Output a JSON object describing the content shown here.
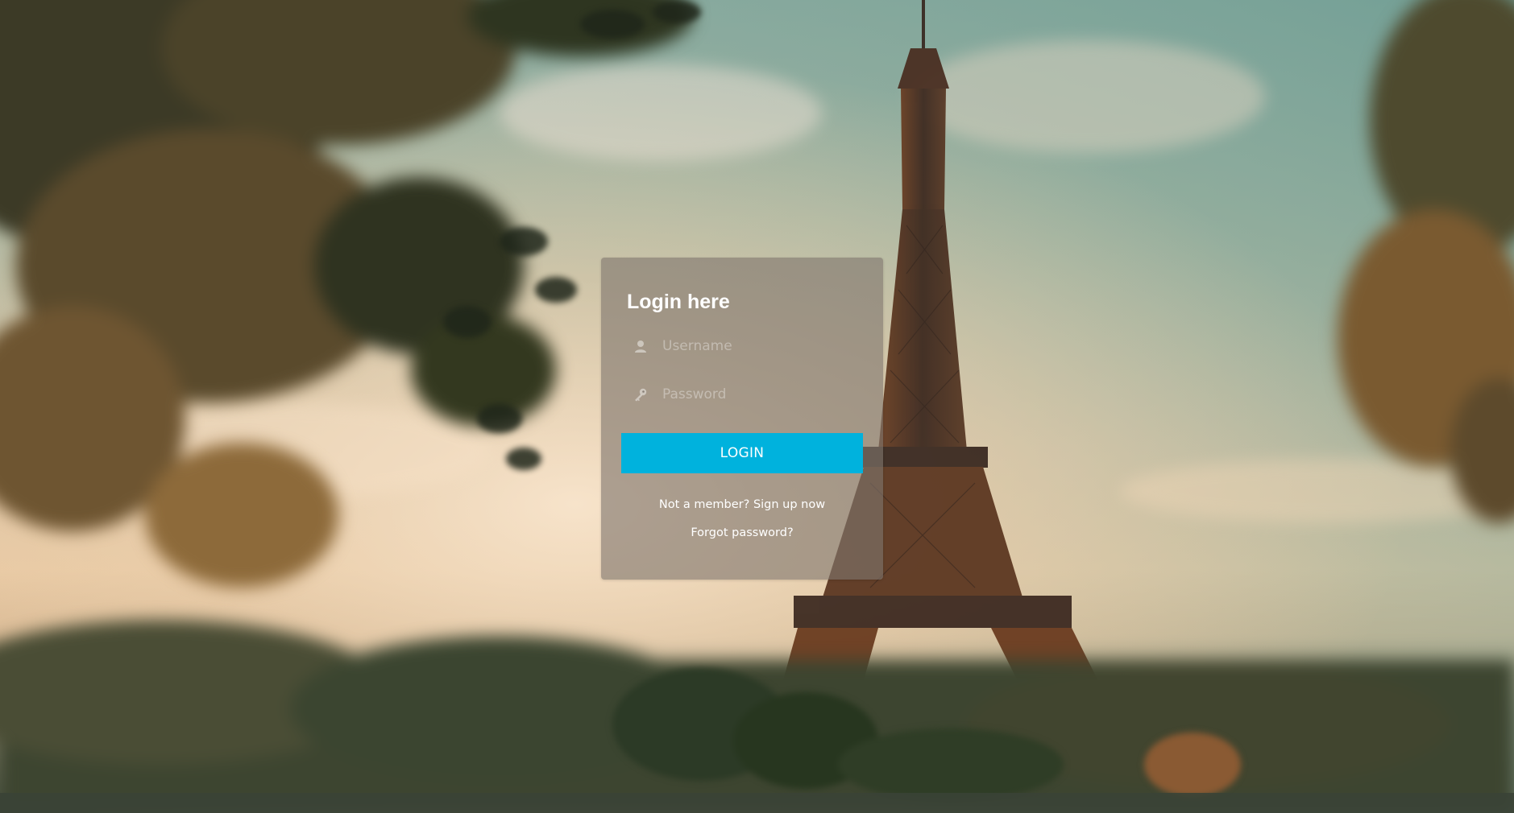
{
  "login": {
    "title": "Login here",
    "username_placeholder": "Username",
    "password_placeholder": "Password",
    "login_label": "LOGIN",
    "signup_link": "Not a member? Sign up now",
    "forgot_link": "Forgot password?"
  },
  "icons": {
    "username": "user-icon",
    "password": "key-icon"
  },
  "colors": {
    "accent": "#00b2dd",
    "card": "rgba(128,118,110,0.62)",
    "text": "#ffffff"
  }
}
